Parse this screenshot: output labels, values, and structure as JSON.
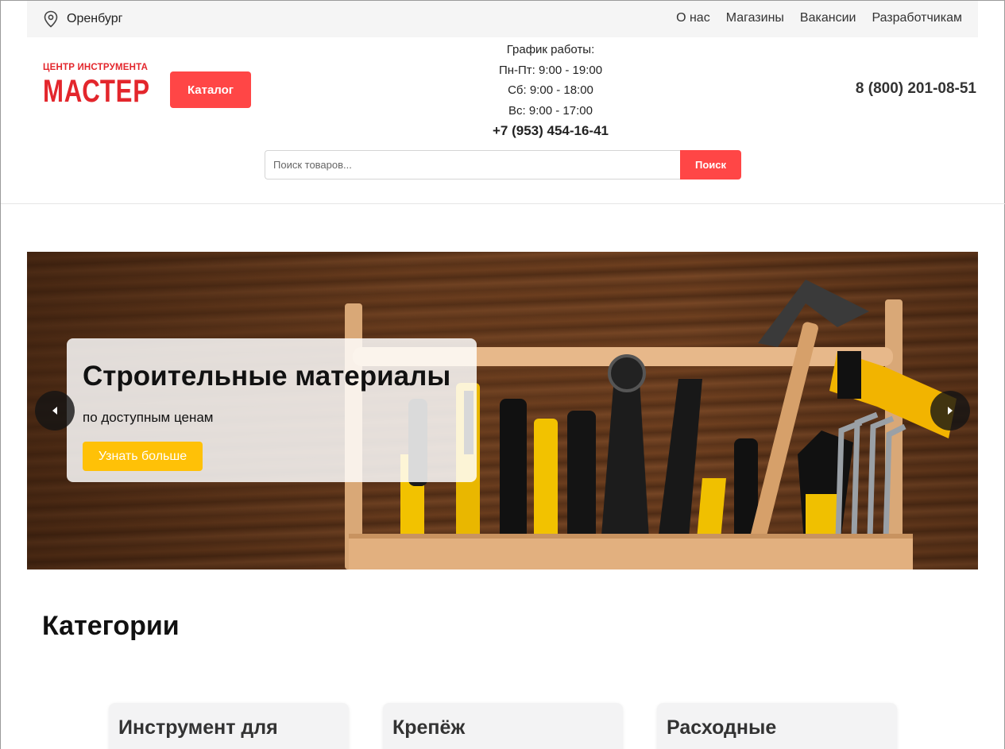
{
  "topbar": {
    "city": "Оренбург",
    "nav": [
      "О нас",
      "Магазины",
      "Вакансии",
      "Разработчикам"
    ]
  },
  "logo": {
    "subtitle": "ЦЕНТР ИНСТРУМЕНТА",
    "name": "МАСТЕР"
  },
  "header": {
    "catalog_label": "Каталог",
    "schedule_title": "График работы:",
    "schedule_weekdays": "Пн-Пт: 9:00 - 19:00",
    "schedule_saturday": "Сб: 9:00 - 18:00",
    "schedule_sunday": "Вс: 9:00 - 17:00",
    "store_phone": "+7 (953) 454-16-41",
    "hotline": "8 (800) 201-08-51"
  },
  "search": {
    "placeholder": "Поиск товаров...",
    "button_label": "Поиск"
  },
  "banner": {
    "title": "Строительные материалы",
    "subtitle": "по доступным ценам",
    "button_label": "Узнать больше"
  },
  "categories": {
    "title": "Категории",
    "items": [
      "Инструмент для",
      "Крепёж",
      "Расходные"
    ]
  },
  "colors": {
    "accent_red": "#ff4646",
    "accent_yellow": "#ffc107",
    "logo_red": "#e3262c"
  }
}
